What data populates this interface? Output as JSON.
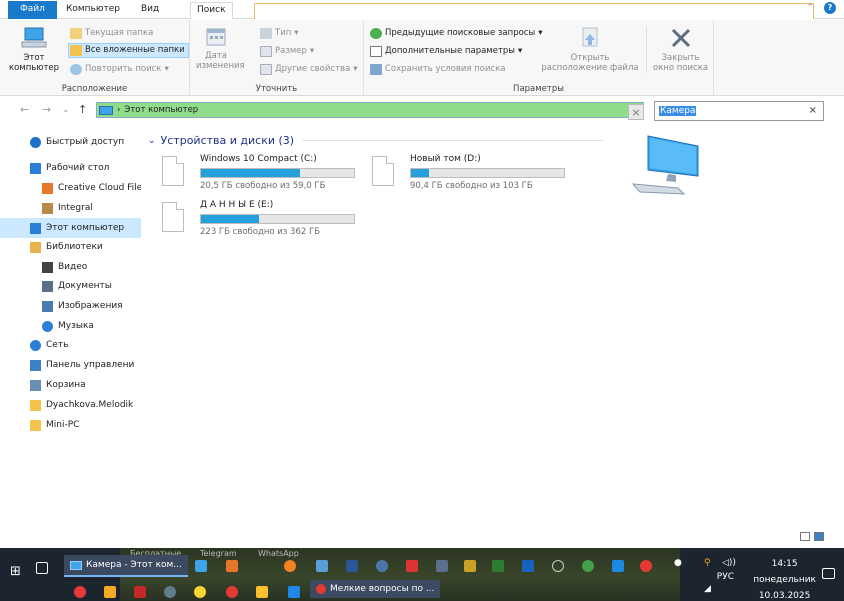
{
  "ribbon_tabs": [
    {
      "label": "Файл"
    },
    {
      "label": "Компьютер"
    },
    {
      "label": "Вид"
    },
    {
      "label": "Поиск"
    }
  ],
  "ribbon": {
    "location": {
      "title": "Расположение",
      "this_pc": "Этот\nкомпьютер",
      "current_folder": "Текущая папка",
      "all_subfolders": "Все вложенные папки",
      "repeat_search": "Повторить поиск"
    },
    "refine": {
      "title": "Уточнить",
      "date_modified": "Дата\nизменения",
      "type": "Тип",
      "size": "Размер",
      "other_props": "Другие свойства"
    },
    "options": {
      "title": "Параметры",
      "recent_searches": "Предыдущие поисковые запросы",
      "advanced": "Дополнительные параметры",
      "save_search": "Сохранить условия поиска",
      "open_location": "Открыть\nрасположение файла",
      "close_search": "Закрыть\nокно поиска"
    }
  },
  "address": {
    "path": "Этот компьютер"
  },
  "search": {
    "query": "Камера"
  },
  "nav_pane": [
    {
      "label": "Быстрый доступ",
      "icon": "star-icon",
      "color": "#1e6fc9"
    },
    {
      "label": "Рабочий стол",
      "icon": "desktop-icon",
      "color": "#2b7fd6"
    },
    {
      "label": "Creative Cloud Files",
      "icon": "creative-cloud-icon",
      "color": "#e8762b"
    },
    {
      "label": "Integral",
      "icon": "user-icon",
      "color": "#b88a4a"
    },
    {
      "label": "Этот компьютер",
      "icon": "this-pc-icon",
      "color": "#2b7fd6"
    },
    {
      "label": "Библиотеки",
      "icon": "libraries-icon",
      "color": "#e8b34a"
    },
    {
      "label": "Видео",
      "icon": "video-icon",
      "color": "#444444"
    },
    {
      "label": "Документы",
      "icon": "documents-icon",
      "color": "#5a6f8a"
    },
    {
      "label": "Изображения",
      "icon": "pictures-icon",
      "color": "#4a7ab0"
    },
    {
      "label": "Музыка",
      "icon": "music-icon",
      "color": "#2b7fd6"
    },
    {
      "label": "Сеть",
      "icon": "network-icon",
      "color": "#2b7fd6"
    },
    {
      "label": "Панель управлени",
      "icon": "control-panel-icon",
      "color": "#3b83c7"
    },
    {
      "label": "Корзина",
      "icon": "recycle-bin-icon",
      "color": "#6a8fb5"
    },
    {
      "label": "Dyachkova.Melodik",
      "icon": "folder-icon",
      "color": "#f3c34d"
    },
    {
      "label": "Mini-PC",
      "icon": "folder-icon",
      "color": "#f3c34d"
    }
  ],
  "devices": {
    "header": "Устройства и диски (3)",
    "drives": [
      {
        "name": "Windows 10 Compact (C:)",
        "free_text": "20,5 ГБ свободно из 59,0 ГБ",
        "used_fraction": 0.65
      },
      {
        "name": "Новый том (D:)",
        "free_text": "90,4 ГБ свободно из 103 ГБ",
        "used_fraction": 0.12
      },
      {
        "name": "Д А Н Н Ы Е (E:)",
        "free_text": "223 ГБ свободно из 362 ГБ",
        "used_fraction": 0.38
      }
    ]
  },
  "taskbar": {
    "ghost_labels": [
      "Бесплатные",
      "Telegram",
      "WhatsApp"
    ],
    "explorer_task": "Камера - Этот ком...",
    "browser_task": "Мелкие вопросы по ...",
    "language": "РУС",
    "time": "14:15",
    "day": "понедельник",
    "date": "10.03.2025"
  },
  "colors": {
    "accent": "#1979ca",
    "selection": "#cce8ff",
    "drive_bar": "#26a0da",
    "address_highlight": "#8fdc8a"
  }
}
